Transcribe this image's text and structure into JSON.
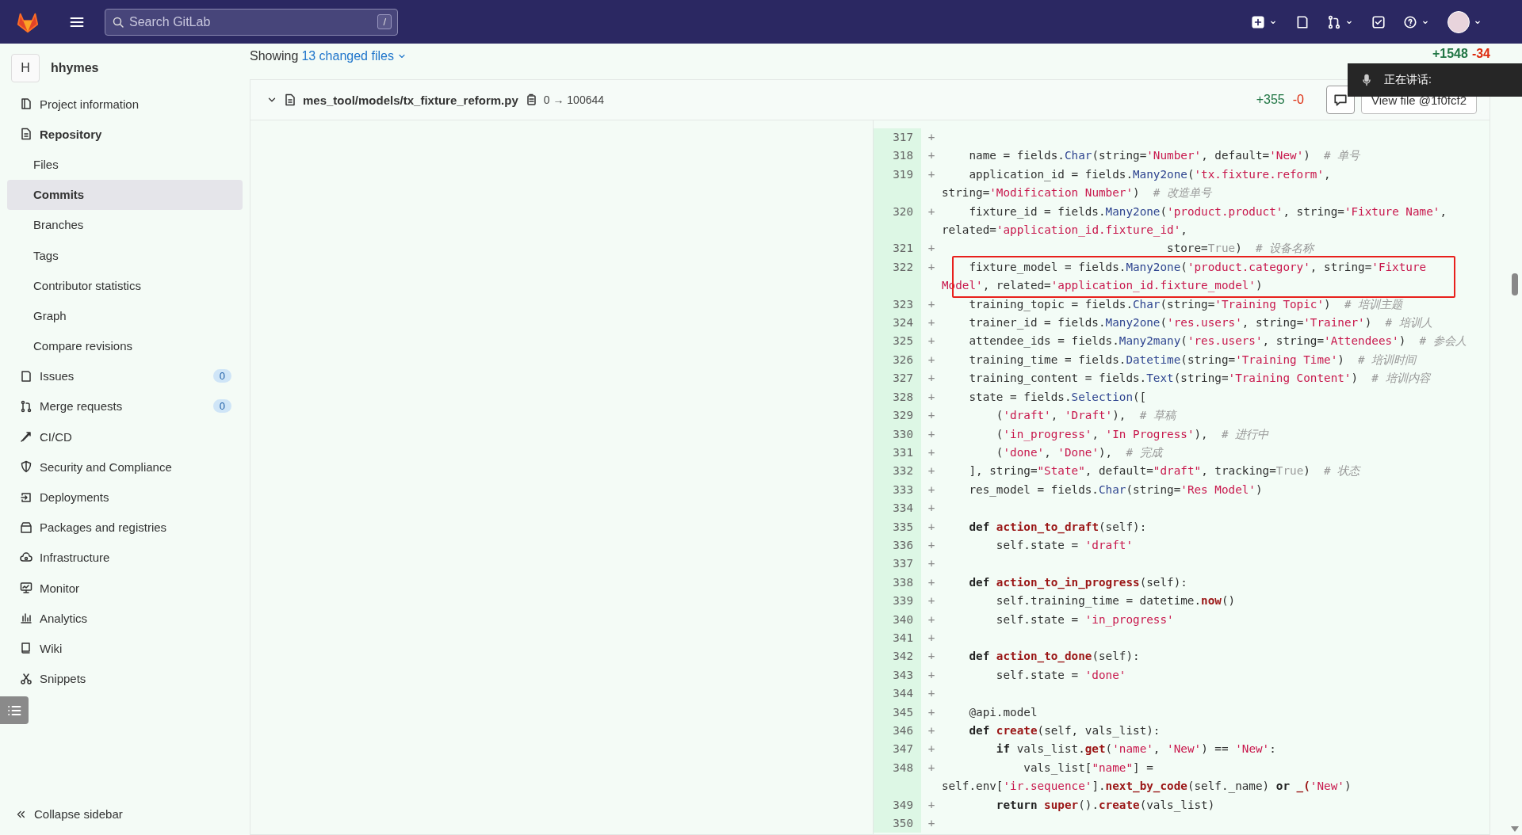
{
  "topbar": {
    "search": {
      "placeholder": "Search GitLab",
      "shortcut": "/"
    }
  },
  "sidebar": {
    "project": {
      "avatar": "H",
      "name": "hhymes"
    },
    "items": [
      {
        "label": "Project information",
        "selected": false
      },
      {
        "label": "Repository",
        "selected": false,
        "expanded": true,
        "children": [
          {
            "label": "Files",
            "selected": false
          },
          {
            "label": "Commits",
            "selected": true
          },
          {
            "label": "Branches",
            "selected": false
          },
          {
            "label": "Tags",
            "selected": false
          },
          {
            "label": "Contributor statistics",
            "selected": false
          },
          {
            "label": "Graph",
            "selected": false
          },
          {
            "label": "Compare revisions",
            "selected": false
          }
        ]
      },
      {
        "label": "Issues",
        "selected": false,
        "badge": "0"
      },
      {
        "label": "Merge requests",
        "selected": false,
        "badge": "0"
      },
      {
        "label": "CI/CD",
        "selected": false
      },
      {
        "label": "Security and Compliance",
        "selected": false
      },
      {
        "label": "Deployments",
        "selected": false
      },
      {
        "label": "Packages and registries",
        "selected": false
      },
      {
        "label": "Infrastructure",
        "selected": false
      },
      {
        "label": "Monitor",
        "selected": false
      },
      {
        "label": "Analytics",
        "selected": false
      },
      {
        "label": "Wiki",
        "selected": false
      },
      {
        "label": "Snippets",
        "selected": false
      }
    ],
    "collapse": "Collapse sidebar"
  },
  "diff": {
    "showing": "Showing",
    "changed_files": "13 changed files",
    "additions": "+1548",
    "deletions": "-34",
    "file": {
      "path": "mes_tool/models/tx_fixture_reform.py",
      "mode": "0 → 100644",
      "additions": "+355",
      "deletions": "-0",
      "view_button": "View file @1f0fcf2",
      "expanded": true
    },
    "lines": [
      {
        "number": "317",
        "sign": "+",
        "annotated": false
      },
      {
        "number": "318",
        "sign": "+",
        "annotated": false,
        "rows": [
          {
            "segments": [
              {
                "kind": "p",
                "text": "    name = fields."
              },
              {
                "kind": "f",
                "text": "Char"
              },
              {
                "kind": "p",
                "text": "(string="
              },
              {
                "kind": "s",
                "text": "'Number'"
              },
              {
                "kind": "p",
                "text": ", default="
              },
              {
                "kind": "s",
                "text": "'New'"
              },
              {
                "kind": "p",
                "text": ")  "
              },
              {
                "kind": "c",
                "text": "# 单号"
              }
            ]
          }
        ]
      },
      {
        "number": "319",
        "sign": "+",
        "annotated": false,
        "rows": [
          {
            "segments": [
              {
                "kind": "p",
                "text": "    application_id = fields."
              },
              {
                "kind": "f",
                "text": "Many2one"
              },
              {
                "kind": "p",
                "text": "("
              },
              {
                "kind": "s",
                "text": "'tx.fixture.reform'"
              },
              {
                "kind": "p",
                "text": ","
              }
            ]
          },
          {
            "segments": [
              {
                "kind": "p",
                "text": "string="
              },
              {
                "kind": "s",
                "text": "'Modification Number'"
              },
              {
                "kind": "p",
                "text": ")  "
              },
              {
                "kind": "c",
                "text": "# 改造单号"
              }
            ]
          }
        ]
      },
      {
        "number": "320",
        "sign": "+",
        "annotated": false,
        "rows": [
          {
            "segments": [
              {
                "kind": "p",
                "text": "    fixture_id = fields."
              },
              {
                "kind": "f",
                "text": "Many2one"
              },
              {
                "kind": "p",
                "text": "("
              },
              {
                "kind": "s",
                "text": "'product.product'"
              },
              {
                "kind": "p",
                "text": ", string="
              },
              {
                "kind": "s",
                "text": "'Fixture Name'"
              },
              {
                "kind": "p",
                "text": ","
              }
            ]
          },
          {
            "segments": [
              {
                "kind": "p",
                "text": "related="
              },
              {
                "kind": "s",
                "text": "'application_id.fixture_id'"
              },
              {
                "kind": "p",
                "text": ","
              }
            ]
          }
        ]
      },
      {
        "number": "321",
        "sign": "+",
        "annotated": false,
        "rows": [
          {
            "segments": [
              {
                "kind": "p",
                "text": "                                 store="
              },
              {
                "kind": "b",
                "text": "True"
              },
              {
                "kind": "p",
                "text": ")  "
              },
              {
                "kind": "c",
                "text": "# 设备名称"
              }
            ]
          }
        ]
      },
      {
        "number": "322",
        "sign": "+",
        "annotated": true,
        "rows": [
          {
            "segments": [
              {
                "kind": "p",
                "text": "    fixture_model = fields."
              },
              {
                "kind": "f",
                "text": "Many2one"
              },
              {
                "kind": "p",
                "text": "("
              },
              {
                "kind": "s",
                "text": "'product.category'"
              },
              {
                "kind": "p",
                "text": ", string="
              },
              {
                "kind": "s",
                "text": "'Fixture"
              }
            ]
          },
          {
            "segments": [
              {
                "kind": "s",
                "text": "Model'"
              },
              {
                "kind": "p",
                "text": ", related="
              },
              {
                "kind": "s",
                "text": "'application_id.fixture_model'"
              },
              {
                "kind": "p",
                "text": ")"
              }
            ]
          }
        ]
      },
      {
        "number": "323",
        "sign": "+",
        "annotated": false,
        "rows": [
          {
            "segments": [
              {
                "kind": "p",
                "text": "    training_topic = fields."
              },
              {
                "kind": "f",
                "text": "Char"
              },
              {
                "kind": "p",
                "text": "(string="
              },
              {
                "kind": "s",
                "text": "'Training Topic'"
              },
              {
                "kind": "p",
                "text": ")  "
              },
              {
                "kind": "c",
                "text": "# 培训主题"
              }
            ]
          }
        ]
      },
      {
        "number": "324",
        "sign": "+",
        "annotated": false,
        "rows": [
          {
            "segments": [
              {
                "kind": "p",
                "text": "    trainer_id = fields."
              },
              {
                "kind": "f",
                "text": "Many2one"
              },
              {
                "kind": "p",
                "text": "("
              },
              {
                "kind": "s",
                "text": "'res.users'"
              },
              {
                "kind": "p",
                "text": ", string="
              },
              {
                "kind": "s",
                "text": "'Trainer'"
              },
              {
                "kind": "p",
                "text": ")  "
              },
              {
                "kind": "c",
                "text": "# 培训人"
              }
            ]
          }
        ]
      },
      {
        "number": "325",
        "sign": "+",
        "annotated": false,
        "rows": [
          {
            "segments": [
              {
                "kind": "p",
                "text": "    attendee_ids = fields."
              },
              {
                "kind": "f",
                "text": "Many2many"
              },
              {
                "kind": "p",
                "text": "("
              },
              {
                "kind": "s",
                "text": "'res.users'"
              },
              {
                "kind": "p",
                "text": ", string="
              },
              {
                "kind": "s",
                "text": "'Attendees'"
              },
              {
                "kind": "p",
                "text": ")  "
              },
              {
                "kind": "c",
                "text": "# 参会人"
              }
            ]
          }
        ]
      },
      {
        "number": "326",
        "sign": "+",
        "annotated": false,
        "rows": [
          {
            "segments": [
              {
                "kind": "p",
                "text": "    training_time = fields."
              },
              {
                "kind": "f",
                "text": "Datetime"
              },
              {
                "kind": "p",
                "text": "(string="
              },
              {
                "kind": "s",
                "text": "'Training Time'"
              },
              {
                "kind": "p",
                "text": ")  "
              },
              {
                "kind": "c",
                "text": "# 培训时间"
              }
            ]
          }
        ]
      },
      {
        "number": "327",
        "sign": "+",
        "annotated": false,
        "rows": [
          {
            "segments": [
              {
                "kind": "p",
                "text": "    training_content = fields."
              },
              {
                "kind": "f",
                "text": "Text"
              },
              {
                "kind": "p",
                "text": "(string="
              },
              {
                "kind": "s",
                "text": "'Training Content'"
              },
              {
                "kind": "p",
                "text": ")  "
              },
              {
                "kind": "c",
                "text": "# 培训内容"
              }
            ]
          }
        ]
      },
      {
        "number": "328",
        "sign": "+",
        "annotated": false,
        "rows": [
          {
            "segments": [
              {
                "kind": "p",
                "text": "    state = fields."
              },
              {
                "kind": "f",
                "text": "Selection"
              },
              {
                "kind": "p",
                "text": "(["
              }
            ]
          }
        ]
      },
      {
        "number": "329",
        "sign": "+",
        "annotated": false,
        "rows": [
          {
            "segments": [
              {
                "kind": "p",
                "text": "        ("
              },
              {
                "kind": "s",
                "text": "'draft'"
              },
              {
                "kind": "p",
                "text": ", "
              },
              {
                "kind": "s",
                "text": "'Draft'"
              },
              {
                "kind": "p",
                "text": "),  "
              },
              {
                "kind": "c",
                "text": "# 草稿"
              }
            ]
          }
        ]
      },
      {
        "number": "330",
        "sign": "+",
        "annotated": false,
        "rows": [
          {
            "segments": [
              {
                "kind": "p",
                "text": "        ("
              },
              {
                "kind": "s",
                "text": "'in_progress'"
              },
              {
                "kind": "p",
                "text": ", "
              },
              {
                "kind": "s",
                "text": "'In Progress'"
              },
              {
                "kind": "p",
                "text": "),  "
              },
              {
                "kind": "c",
                "text": "# 进行中"
              }
            ]
          }
        ]
      },
      {
        "number": "331",
        "sign": "+",
        "annotated": false,
        "rows": [
          {
            "segments": [
              {
                "kind": "p",
                "text": "        ("
              },
              {
                "kind": "s",
                "text": "'done'"
              },
              {
                "kind": "p",
                "text": ", "
              },
              {
                "kind": "s",
                "text": "'Done'"
              },
              {
                "kind": "p",
                "text": "),  "
              },
              {
                "kind": "c",
                "text": "# 完成"
              }
            ]
          }
        ]
      },
      {
        "number": "332",
        "sign": "+",
        "annotated": false,
        "rows": [
          {
            "segments": [
              {
                "kind": "p",
                "text": "    ], string="
              },
              {
                "kind": "s",
                "text": "\"State\""
              },
              {
                "kind": "p",
                "text": ", default="
              },
              {
                "kind": "s",
                "text": "\"draft\""
              },
              {
                "kind": "p",
                "text": ", tracking="
              },
              {
                "kind": "b",
                "text": "True"
              },
              {
                "kind": "p",
                "text": ")  "
              },
              {
                "kind": "c",
                "text": "# 状态"
              }
            ]
          }
        ]
      },
      {
        "number": "333",
        "sign": "+",
        "annotated": false,
        "rows": [
          {
            "segments": [
              {
                "kind": "p",
                "text": "    res_model = fields."
              },
              {
                "kind": "f",
                "text": "Char"
              },
              {
                "kind": "p",
                "text": "(string="
              },
              {
                "kind": "s",
                "text": "'Res Model'"
              },
              {
                "kind": "p",
                "text": ")"
              }
            ]
          }
        ]
      },
      {
        "number": "334",
        "sign": "+",
        "annotated": false
      },
      {
        "number": "335",
        "sign": "+",
        "annotated": false,
        "rows": [
          {
            "segments": [
              {
                "kind": "k",
                "text": "    def"
              },
              {
                "kind": "d",
                "text": " action_to_draft"
              },
              {
                "kind": "p",
                "text": "(self):"
              }
            ]
          }
        ]
      },
      {
        "number": "336",
        "sign": "+",
        "annotated": false,
        "rows": [
          {
            "segments": [
              {
                "kind": "p",
                "text": "        self.state = "
              },
              {
                "kind": "s",
                "text": "'draft'"
              }
            ]
          }
        ]
      },
      {
        "number": "337",
        "sign": "+",
        "annotated": false
      },
      {
        "number": "338",
        "sign": "+",
        "annotated": false,
        "rows": [
          {
            "segments": [
              {
                "kind": "k",
                "text": "    def"
              },
              {
                "kind": "d",
                "text": " action_to_in_progress"
              },
              {
                "kind": "p",
                "text": "(self):"
              }
            ]
          }
        ]
      },
      {
        "number": "339",
        "sign": "+",
        "annotated": false,
        "rows": [
          {
            "segments": [
              {
                "kind": "p",
                "text": "        self.training_time = datetime."
              },
              {
                "kind": "d",
                "text": "now"
              },
              {
                "kind": "p",
                "text": "()"
              }
            ]
          }
        ]
      },
      {
        "number": "340",
        "sign": "+",
        "annotated": false,
        "rows": [
          {
            "segments": [
              {
                "kind": "p",
                "text": "        self.state = "
              },
              {
                "kind": "s",
                "text": "'in_progress'"
              }
            ]
          }
        ]
      },
      {
        "number": "341",
        "sign": "+",
        "annotated": false
      },
      {
        "number": "342",
        "sign": "+",
        "annotated": false,
        "rows": [
          {
            "segments": [
              {
                "kind": "k",
                "text": "    def"
              },
              {
                "kind": "d",
                "text": " action_to_done"
              },
              {
                "kind": "p",
                "text": "(self):"
              }
            ]
          }
        ]
      },
      {
        "number": "343",
        "sign": "+",
        "annotated": false,
        "rows": [
          {
            "segments": [
              {
                "kind": "p",
                "text": "        self.state = "
              },
              {
                "kind": "s",
                "text": "'done'"
              }
            ]
          }
        ]
      },
      {
        "number": "344",
        "sign": "+",
        "annotated": false
      },
      {
        "number": "345",
        "sign": "+",
        "annotated": false,
        "rows": [
          {
            "segments": [
              {
                "kind": "p",
                "text": "    @api.model"
              }
            ]
          }
        ]
      },
      {
        "number": "346",
        "sign": "+",
        "annotated": false,
        "rows": [
          {
            "segments": [
              {
                "kind": "k",
                "text": "    def"
              },
              {
                "kind": "d",
                "text": " create"
              },
              {
                "kind": "p",
                "text": "(self, vals_list):"
              }
            ]
          }
        ]
      },
      {
        "number": "347",
        "sign": "+",
        "annotated": false,
        "rows": [
          {
            "segments": [
              {
                "kind": "k",
                "text": "        if"
              },
              {
                "kind": "p",
                "text": " vals_list."
              },
              {
                "kind": "d",
                "text": "get"
              },
              {
                "kind": "p",
                "text": "("
              },
              {
                "kind": "s",
                "text": "'name'"
              },
              {
                "kind": "p",
                "text": ", "
              },
              {
                "kind": "s",
                "text": "'New'"
              },
              {
                "kind": "p",
                "text": ") == "
              },
              {
                "kind": "s",
                "text": "'New'"
              },
              {
                "kind": "p",
                "text": ":"
              }
            ]
          }
        ]
      },
      {
        "number": "348",
        "sign": "+",
        "annotated": false,
        "rows": [
          {
            "segments": [
              {
                "kind": "p",
                "text": "            vals_list["
              },
              {
                "kind": "s",
                "text": "\"name\""
              },
              {
                "kind": "p",
                "text": "] ="
              }
            ]
          },
          {
            "segments": [
              {
                "kind": "p",
                "text": "self.env["
              },
              {
                "kind": "s",
                "text": "'ir.sequence'"
              },
              {
                "kind": "p",
                "text": "]."
              },
              {
                "kind": "d",
                "text": "next_by_code"
              },
              {
                "kind": "p",
                "text": "(self._name) "
              },
              {
                "kind": "k",
                "text": "or"
              },
              {
                "kind": "d",
                "text": " _("
              },
              {
                "kind": "s",
                "text": "'New'"
              },
              {
                "kind": "p",
                "text": ")"
              }
            ]
          }
        ]
      },
      {
        "number": "349",
        "sign": "+",
        "annotated": false,
        "rows": [
          {
            "segments": [
              {
                "kind": "k",
                "text": "        return"
              },
              {
                "kind": "d",
                "text": " super"
              },
              {
                "kind": "p",
                "text": "()."
              },
              {
                "kind": "d",
                "text": "create"
              },
              {
                "kind": "p",
                "text": "(vals_list)"
              }
            ]
          }
        ]
      },
      {
        "number": "350",
        "sign": "+",
        "annotated": false
      }
    ]
  },
  "speaking_overlay": {
    "text": "正在讲话:"
  }
}
